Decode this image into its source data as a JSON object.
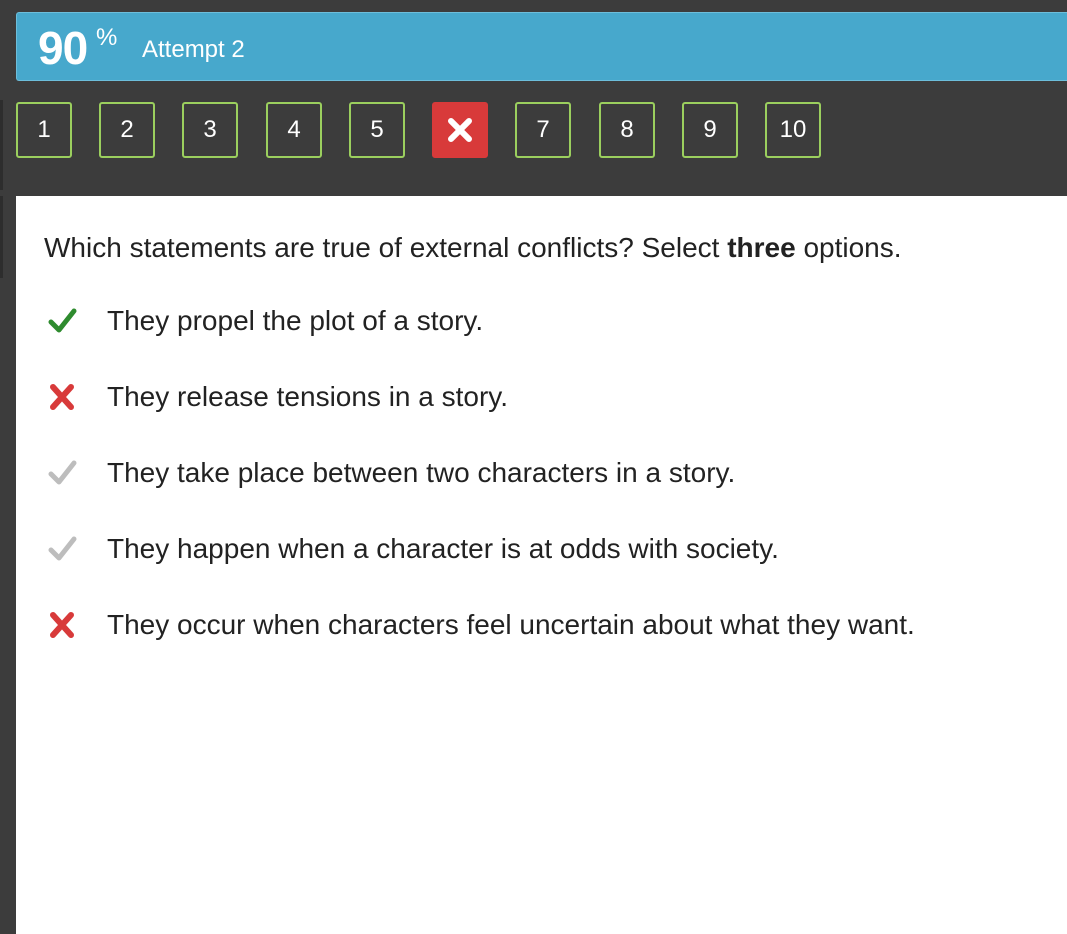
{
  "header": {
    "score_value": "90",
    "score_unit": "%",
    "attempt_label": "Attempt 2"
  },
  "question_nav": [
    {
      "label": "1",
      "status": "answered"
    },
    {
      "label": "2",
      "status": "answered"
    },
    {
      "label": "3",
      "status": "answered"
    },
    {
      "label": "4",
      "status": "answered"
    },
    {
      "label": "5",
      "status": "answered"
    },
    {
      "label": "",
      "status": "incorrect",
      "icon": "x-icon"
    },
    {
      "label": "7",
      "status": "answered"
    },
    {
      "label": "8",
      "status": "answered"
    },
    {
      "label": "9",
      "status": "answered"
    },
    {
      "label": "10",
      "status": "answered"
    }
  ],
  "question": {
    "prompt_before": "Which statements are true of external conflicts? Select ",
    "prompt_bold": "three",
    "prompt_after": " options."
  },
  "options": [
    {
      "text": "They propel the plot of a story.",
      "mark": "correct-check-icon"
    },
    {
      "text": "They release tensions in a story.",
      "mark": "incorrect-x-icon"
    },
    {
      "text": "They take place between two characters in a story.",
      "mark": "gray-check-icon"
    },
    {
      "text": "They happen when a character is at odds with society.",
      "mark": "gray-check-icon"
    },
    {
      "text": "They occur when characters feel uncertain about what they want.",
      "mark": "incorrect-x-icon"
    }
  ],
  "colors": {
    "header_blue": "#47a8cc",
    "nav_border_green": "#9bcf5e",
    "wrong_red": "#d83a3a",
    "check_green": "#2e8b2e",
    "check_gray": "#bdbdbd",
    "background_dark": "#3c3c3c"
  }
}
